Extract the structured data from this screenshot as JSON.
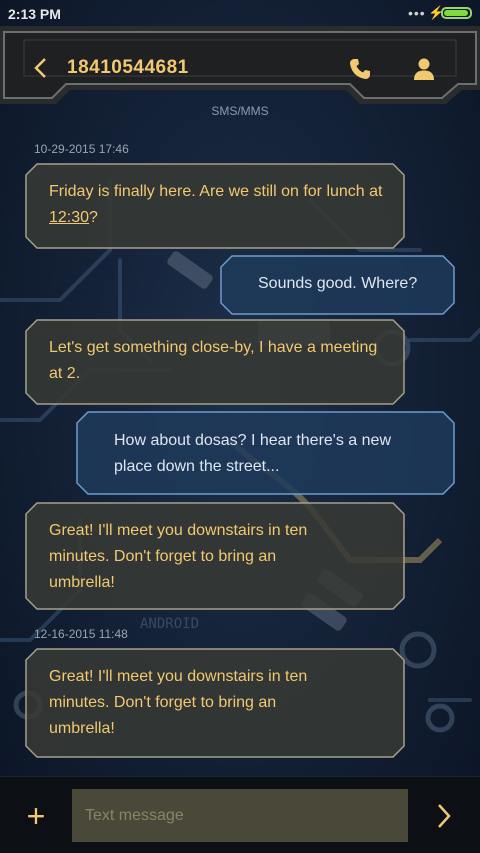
{
  "status_bar": {
    "time": "2:13 PM",
    "signal_dots": "•••",
    "charging_icon": "bolt-icon",
    "battery_level": 0.9
  },
  "header": {
    "back_icon": "chevron-left-icon",
    "contact": "18410544681",
    "call_icon": "phone-icon",
    "contact_icon": "person-icon"
  },
  "thread": {
    "channel_label": "SMS/MMS",
    "groups": [
      {
        "timestamp": "10-29-2015 17:46",
        "messages": [
          {
            "direction": "incoming",
            "text_before": "Friday is finally here. Are we still on for lunch at ",
            "link": "12:30",
            "text_after": "?"
          },
          {
            "direction": "outgoing",
            "text": "Sounds good. Where?"
          },
          {
            "direction": "incoming",
            "text": "Let's get something close-by, I have a meeting at 2."
          },
          {
            "direction": "outgoing",
            "text": "How about dosas? I hear there's a new place down the street..."
          },
          {
            "direction": "incoming",
            "text": "Great! I'll meet you downstairs in ten minutes. Don't forget to bring an umbrella!"
          }
        ]
      },
      {
        "timestamp": "12-16-2015 11:48",
        "messages": [
          {
            "direction": "incoming",
            "text": "Great! I'll meet you downstairs in ten minutes. Don't forget to bring an umbrella!"
          }
        ]
      }
    ]
  },
  "composer": {
    "placeholder": "Text message",
    "add_icon": "plus-icon",
    "send_icon": "chevron-right-icon"
  },
  "colors": {
    "accent": "#f2c970",
    "background": "#142238",
    "incoming_bubble": "#3b3c38",
    "outgoing_bubble": "#23405e"
  }
}
